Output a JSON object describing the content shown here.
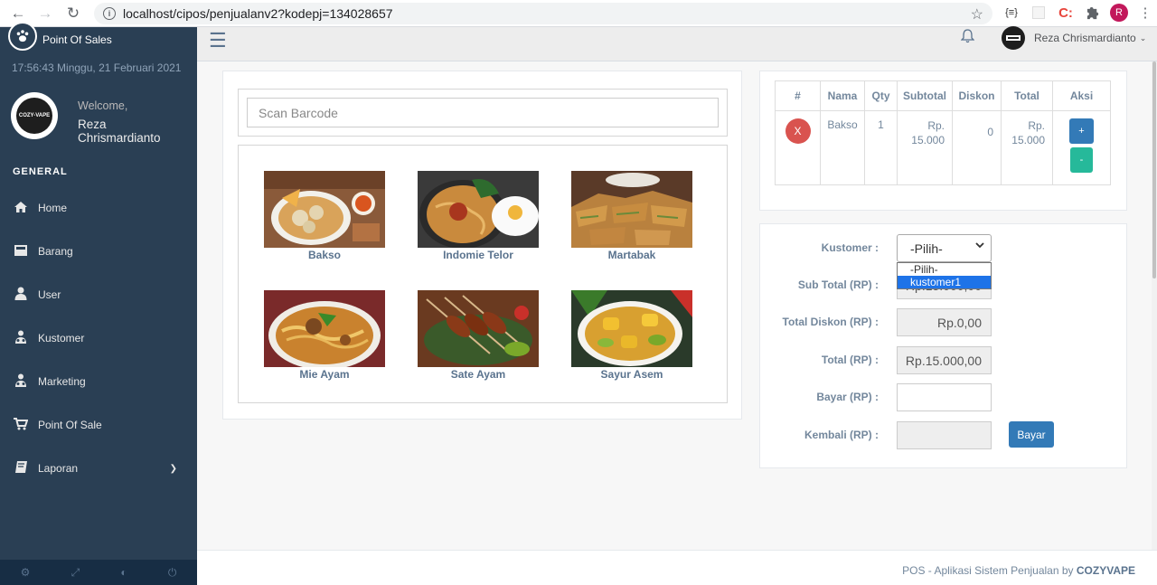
{
  "browser": {
    "url": "localhost/cipos/penjualanv2?kodepj=134028657",
    "ext_label": "{≡}",
    "ext_c": "C:",
    "profile_initial": "R"
  },
  "sidebar": {
    "brand": "Point Of Sales",
    "datetime": "17:56:43 Minggu, 21 Februari 2021",
    "logo_text": "COZY-VAPE",
    "welcome": "Welcome,",
    "username": "Reza Chrismardianto",
    "section": "GENERAL",
    "items": [
      {
        "label": "Home",
        "icon": "home-icon"
      },
      {
        "label": "Barang",
        "icon": "box-icon"
      },
      {
        "label": "User",
        "icon": "user-icon"
      },
      {
        "label": "Kustomer",
        "icon": "users-icon"
      },
      {
        "label": "Marketing",
        "icon": "users-icon"
      },
      {
        "label": "Point Of Sale",
        "icon": "cart-icon"
      },
      {
        "label": "Laporan",
        "icon": "book-icon"
      }
    ]
  },
  "topnav": {
    "user_name": "Reza Chrismardianto"
  },
  "scan": {
    "placeholder": "Scan Barcode"
  },
  "products": [
    {
      "name": "Bakso"
    },
    {
      "name": "Indomie Telor"
    },
    {
      "name": "Martabak"
    },
    {
      "name": "Mie Ayam"
    },
    {
      "name": "Sate Ayam"
    },
    {
      "name": "Sayur Asem"
    }
  ],
  "cart": {
    "headers": [
      "#",
      "Nama",
      "Qty",
      "Subtotal",
      "Diskon",
      "Total",
      "Aksi"
    ],
    "rows": [
      {
        "remove": "X",
        "nama": "Bakso",
        "qty": "1",
        "subtotal": "Rp. 15.000",
        "diskon": "0",
        "total": "Rp. 15.000",
        "plus": "+",
        "minus": "-"
      }
    ]
  },
  "payment": {
    "kustomer_label": "Kustomer :",
    "kustomer_value": "-Pilih-",
    "kustomer_options": [
      "-Pilih-",
      "kustomer1"
    ],
    "subtotal_label": "Sub Total (RP) :",
    "subtotal_value": "Rp.15.000,00",
    "diskon_label": "Total Diskon (RP) :",
    "diskon_value": "Rp.0,00",
    "total_label": "Total (RP) :",
    "total_value": "Rp.15.000,00",
    "bayar_label": "Bayar (RP) :",
    "bayar_value": "",
    "kembali_label": "Kembali (RP) :",
    "kembali_value": "",
    "bayar_button": "Bayar"
  },
  "footer": {
    "text": "POS - Aplikasi Sistem Penjualan by",
    "brand": "COZYVAPE"
  }
}
